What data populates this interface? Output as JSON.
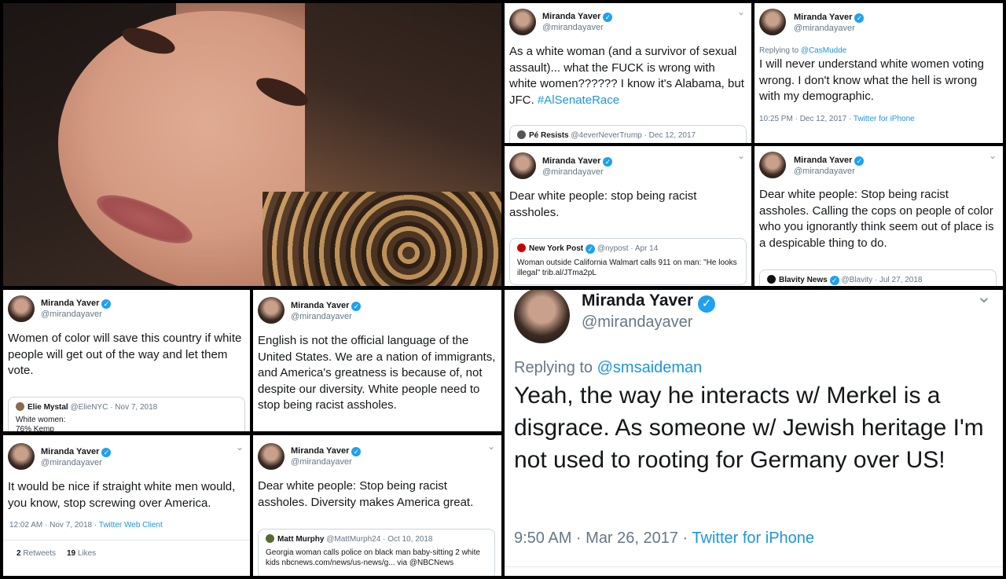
{
  "profile": {
    "name": "Miranda Yaver",
    "handle": "@mirandayaver",
    "verified_mark": "✓",
    "chevron": "⌄"
  },
  "tweets": {
    "t1": {
      "body_1": "As a white woman (and a survivor of sexual assault)... what the FUCK is wrong with white women?????? I know it's Alabama, but JFC. ",
      "hashtag": "#AlSenateRace",
      "quote": {
        "name": "Pé Resists",
        "handle": "@4everNeverTrump · Dec 12, 2017"
      }
    },
    "t2": {
      "reply_label": "Replying to ",
      "reply_to": "@CasMudde",
      "body": "I will never understand white women voting wrong. I don't know what the hell is wrong with my demographic.",
      "time": "10:25 PM · Dec 12, 2017 · ",
      "client": "Twitter for iPhone"
    },
    "t3": {
      "body": "Dear white people: stop being racist assholes.",
      "quote": {
        "name": "New York Post",
        "handle": "@nypost · Apr 14",
        "text": "Woman outside California Walmart calls 911 on man: \"He looks illegal\" trib.al/JTma2pL"
      }
    },
    "t4": {
      "body": "Dear white people: Stop being racist assholes. Calling the cops on people of color who you ignorantly think seem out of place is a despicable thing to do.",
      "quote": {
        "name": "Blavity News",
        "handle": "@Blavity · Jul 27, 2018"
      }
    },
    "t5": {
      "body": "Women of color will save this country if white people will get out of the way and let them vote.",
      "quote": {
        "name": "Elie Mystal",
        "handle": "@ElieNYC · Nov 7, 2018",
        "text": "White women:",
        "text2": "76% Kemp"
      }
    },
    "t6": {
      "body": "English is not the official language of the United States. We are a nation of immigrants, and America's greatness is because of, not despite our diversity. White people need to stop being racist assholes."
    },
    "t7": {
      "reply_label": "Replying to ",
      "reply_to": "@smsaideman",
      "body": "Yeah, the way he interacts w/ Merkel is a disgrace. As someone w/ Jewish heritage I'm not used to rooting for Germany over US!",
      "time": "9:50 AM · Mar 26, 2017 · ",
      "client": "Twitter for iPhone"
    },
    "t8": {
      "body": "It would be nice if straight white men would, you know, stop screwing over America.",
      "time": "12:02 AM · Nov 7, 2018 · ",
      "client": "Twitter Web Client",
      "retweets_n": "2",
      "retweets_l": " Retweets",
      "likes_n": "19",
      "likes_l": " Likes"
    },
    "t9": {
      "body": "Dear white people: Stop being racist assholes. Diversity makes America great.",
      "quote": {
        "name": "Matt Murphy",
        "handle": "@MattMurph24 · Oct 10, 2018",
        "text": "Georgia woman calls police on black man baby-sitting 2 white kids nbcnews.com/news/us-news/g... via @NBCNews"
      }
    }
  },
  "colors": {
    "accent": "#1da1f2",
    "link": "#1b95e0",
    "muted": "#657786",
    "text": "#14171a"
  }
}
